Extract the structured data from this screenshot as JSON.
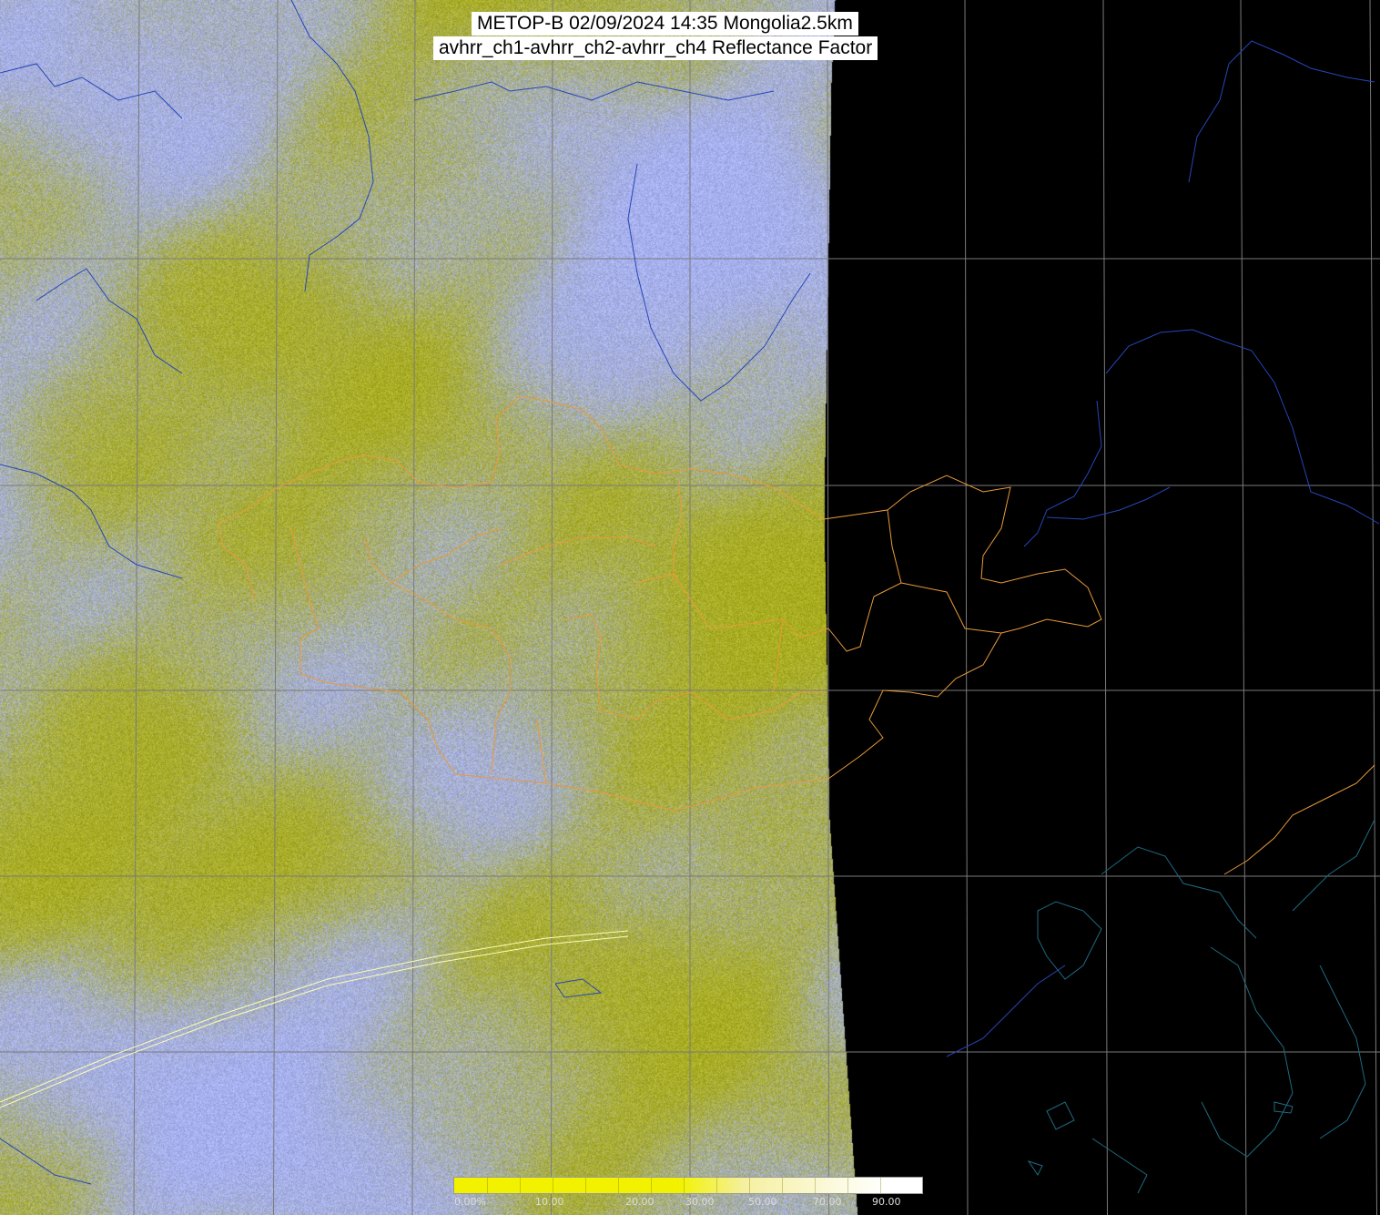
{
  "title": {
    "line1": "METOP-B 02/09/2024 14:35 Mongolia2.5km",
    "line2": "avhrr_ch1-avhrr_ch2-avhrr_ch4 Reflectance Factor"
  },
  "colorbar": {
    "labels": [
      "0.00%",
      "10.00",
      "20.00",
      "30.00",
      "50.00",
      "70.00",
      "90.00"
    ],
    "colors": {
      "low": "#f2f200",
      "mid": "#f5f0a0",
      "high": "#ffffff"
    }
  },
  "colors": {
    "background": "#000000",
    "cloud": "#a6b0f0",
    "ground": "#a9ad1f",
    "gridline": "#7a7a7a",
    "rivers_coast": "#2546b8",
    "borders": "#e89a3a",
    "coast_dark": "#1f6a80",
    "swath_edge_trail": "#fffdb0"
  }
}
